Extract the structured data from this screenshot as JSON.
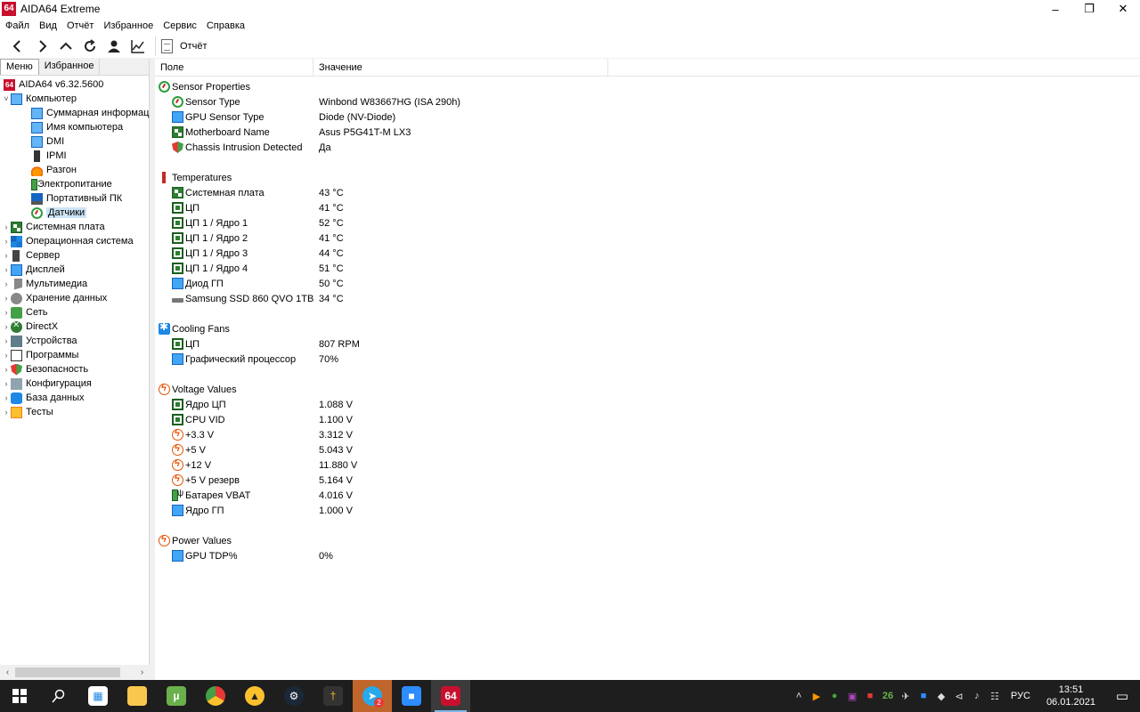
{
  "window": {
    "title": "AIDA64 Extreme",
    "icon_text": "64",
    "controls": [
      "minimize-icon",
      "restore-icon",
      "close-icon"
    ]
  },
  "menu": {
    "items": [
      "Файл",
      "Вид",
      "Отчёт",
      "Избранное",
      "Сервис",
      "Справка"
    ]
  },
  "toolbar": {
    "report_label": "Отчёт"
  },
  "left_tabs": [
    "Меню",
    "Избранное"
  ],
  "tree": {
    "items": [
      {
        "label": "AIDA64 v6.32.5600",
        "icon": "aida",
        "level": 0,
        "chev": ""
      },
      {
        "label": "Компьютер",
        "icon": "computer",
        "level": 0,
        "chev": "v"
      },
      {
        "label": "Суммарная информация",
        "icon": "computer",
        "level": 1,
        "chev": ""
      },
      {
        "label": "Имя компьютера",
        "icon": "computer",
        "level": 1,
        "chev": ""
      },
      {
        "label": "DMI",
        "icon": "computer",
        "level": 1,
        "chev": ""
      },
      {
        "label": "IPMI",
        "icon": "ipmi",
        "level": 1,
        "chev": ""
      },
      {
        "label": "Разгон",
        "icon": "fire",
        "level": 1,
        "chev": ""
      },
      {
        "label": "Электропитание",
        "icon": "batt",
        "level": 1,
        "chev": ""
      },
      {
        "label": "Портативный ПК",
        "icon": "laptop",
        "level": 1,
        "chev": ""
      },
      {
        "label": "Датчики",
        "icon": "sensor",
        "level": 1,
        "chev": "",
        "selected": true
      },
      {
        "label": "Системная плата",
        "icon": "board",
        "level": 0,
        "chev": ">"
      },
      {
        "label": "Операционная система",
        "icon": "win",
        "level": 0,
        "chev": ">"
      },
      {
        "label": "Сервер",
        "icon": "server",
        "level": 0,
        "chev": ">"
      },
      {
        "label": "Дисплей",
        "icon": "monitor",
        "level": 0,
        "chev": ">"
      },
      {
        "label": "Мультимедиа",
        "icon": "media",
        "level": 0,
        "chev": ">"
      },
      {
        "label": "Хранение данных",
        "icon": "storage",
        "level": 0,
        "chev": ">"
      },
      {
        "label": "Сеть",
        "icon": "network",
        "level": 0,
        "chev": ">"
      },
      {
        "label": "DirectX",
        "icon": "xbox",
        "level": 0,
        "chev": ">"
      },
      {
        "label": "Устройства",
        "icon": "devices",
        "level": 0,
        "chev": ">"
      },
      {
        "label": "Программы",
        "icon": "prog",
        "level": 0,
        "chev": ">"
      },
      {
        "label": "Безопасность",
        "icon": "sec",
        "level": 0,
        "chev": ">"
      },
      {
        "label": "Конфигурация",
        "icon": "config",
        "level": 0,
        "chev": ">"
      },
      {
        "label": "База данных",
        "icon": "db",
        "level": 0,
        "chev": ">"
      },
      {
        "label": "Тесты",
        "icon": "tests",
        "level": 0,
        "chev": ">"
      }
    ]
  },
  "table": {
    "columns": [
      "Поле",
      "Значение"
    ],
    "sections": [
      {
        "title": "Sensor Properties",
        "icon": "sensor",
        "rows": [
          {
            "field": "Sensor Type",
            "value": "Winbond W83667HG  (ISA 290h)",
            "icon": "sensor"
          },
          {
            "field": "GPU Sensor Type",
            "value": "Diode  (NV-Diode)",
            "icon": "monitor"
          },
          {
            "field": "Motherboard Name",
            "value": "Asus P5G41T-M LX3",
            "icon": "board"
          },
          {
            "field": "Chassis Intrusion Detected",
            "value": "Да",
            "icon": "shield"
          }
        ]
      },
      {
        "title": "Temperatures",
        "icon": "therm",
        "rows": [
          {
            "field": "Системная плата",
            "value": "43 °C",
            "icon": "board"
          },
          {
            "field": "ЦП",
            "value": "41 °C",
            "icon": "cpu"
          },
          {
            "field": "ЦП 1 / Ядро 1",
            "value": "52 °C",
            "icon": "cpu"
          },
          {
            "field": "ЦП 1 / Ядро 2",
            "value": "41 °C",
            "icon": "cpu"
          },
          {
            "field": "ЦП 1 / Ядро 3",
            "value": "44 °C",
            "icon": "cpu"
          },
          {
            "field": "ЦП 1 / Ядро 4",
            "value": "51 °C",
            "icon": "cpu"
          },
          {
            "field": "Диод ГП",
            "value": "50 °C",
            "icon": "monitor"
          },
          {
            "field": "Samsung SSD 860 QVO 1TB",
            "value": "34 °C",
            "icon": "ssd"
          }
        ]
      },
      {
        "title": "Cooling Fans",
        "icon": "fan",
        "rows": [
          {
            "field": "ЦП",
            "value": "807 RPM",
            "icon": "cpu"
          },
          {
            "field": "Графический процессор",
            "value": "70%",
            "icon": "monitor"
          }
        ]
      },
      {
        "title": "Voltage Values",
        "icon": "volt",
        "rows": [
          {
            "field": "Ядро ЦП",
            "value": "1.088 V",
            "icon": "cpu"
          },
          {
            "field": "CPU VID",
            "value": "1.100 V",
            "icon": "cpu"
          },
          {
            "field": "+3.3 V",
            "value": "3.312 V",
            "icon": "volt"
          },
          {
            "field": "+5 V",
            "value": "5.043 V",
            "icon": "volt"
          },
          {
            "field": "+12 V",
            "value": "11.880 V",
            "icon": "volt"
          },
          {
            "field": "+5 V резерв",
            "value": "5.164 V",
            "icon": "volt"
          },
          {
            "field": "Батарея VBAT",
            "value": "4.016 V",
            "icon": "batt"
          },
          {
            "field": "Ядро ГП",
            "value": "1.000 V",
            "icon": "monitor"
          }
        ]
      },
      {
        "title": "Power Values",
        "icon": "volt",
        "rows": [
          {
            "field": "GPU TDP%",
            "value": "0%",
            "icon": "monitor"
          }
        ]
      }
    ]
  },
  "taskbar": {
    "apps": [
      {
        "name": "start-button",
        "glyph": "win"
      },
      {
        "name": "search-button",
        "glyph": "search"
      },
      {
        "name": "store-app",
        "glyph": "store"
      },
      {
        "name": "file-explorer-app",
        "glyph": "folder"
      },
      {
        "name": "utorrent-app",
        "glyph": "utorrent"
      },
      {
        "name": "chrome-app",
        "glyph": "chrome"
      },
      {
        "name": "archicad-app",
        "glyph": "triangle"
      },
      {
        "name": "steam-app",
        "glyph": "steam"
      },
      {
        "name": "game-app",
        "glyph": "game"
      },
      {
        "name": "telegram-app",
        "glyph": "telegram",
        "badge": "2"
      },
      {
        "name": "zoom-app",
        "glyph": "zoom"
      },
      {
        "name": "aida64-app",
        "glyph": "aida",
        "label": "64"
      }
    ],
    "tray_icons": [
      "chevron-up-icon",
      "media-icon",
      "kaspersky-icon",
      "chat-icon",
      "app-icon",
      "counter-icon",
      "airplane-icon",
      "meet-icon",
      "shield-icon",
      "network-icon",
      "volume-icon",
      "ime-icon"
    ],
    "tray_counter": "26",
    "language": "РУС",
    "time": "13:51",
    "date": "06.01.2021"
  }
}
